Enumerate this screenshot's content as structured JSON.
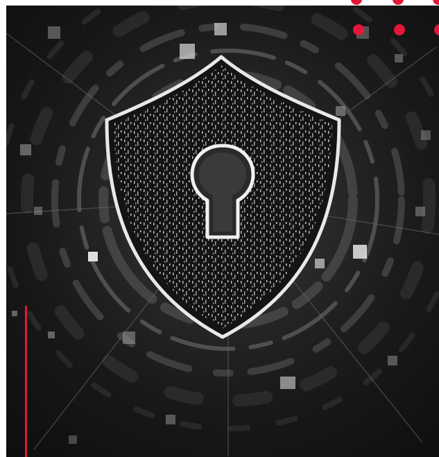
{
  "image": {
    "subject": "shield-with-keyhole",
    "style": "grayscale-cyber-security",
    "accent_color": "#e4173a",
    "icons": [
      "shield-icon",
      "keyhole-icon"
    ]
  }
}
